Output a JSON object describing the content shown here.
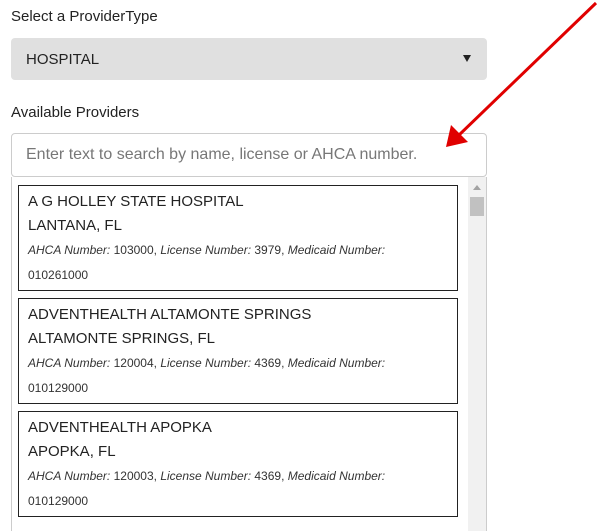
{
  "provider_type": {
    "label": "Select a ProviderType",
    "selected": "HOSPITAL"
  },
  "available": {
    "label": "Available Providers",
    "search_placeholder": "Enter text to search by name, license or AHCA number."
  },
  "providers": [
    {
      "name": "A G HOLLEY STATE HOSPITAL",
      "location": "LANTANA, FL",
      "ahca_label": "AHCA Number:",
      "ahca": "103000",
      "license_label": "License Number:",
      "license": "3979",
      "medicaid_label": "Medicaid Number:",
      "medicaid": "010261000"
    },
    {
      "name": "ADVENTHEALTH ALTAMONTE SPRINGS",
      "location": "ALTAMONTE SPRINGS, FL",
      "ahca_label": "AHCA Number:",
      "ahca": "120004",
      "license_label": "License Number:",
      "license": "4369",
      "medicaid_label": "Medicaid Number:",
      "medicaid": "010129000"
    },
    {
      "name": "ADVENTHEALTH APOPKA",
      "location": "APOPKA, FL",
      "ahca_label": "AHCA Number:",
      "ahca": "120003",
      "license_label": "License Number:",
      "license": "4369",
      "medicaid_label": "Medicaid Number:",
      "medicaid": "010129000"
    }
  ],
  "annotation": {
    "arrow_color": "#e00000"
  },
  "icons": {
    "dropdown": "chevron-down-icon",
    "scroll_up": "scroll-up-icon"
  }
}
